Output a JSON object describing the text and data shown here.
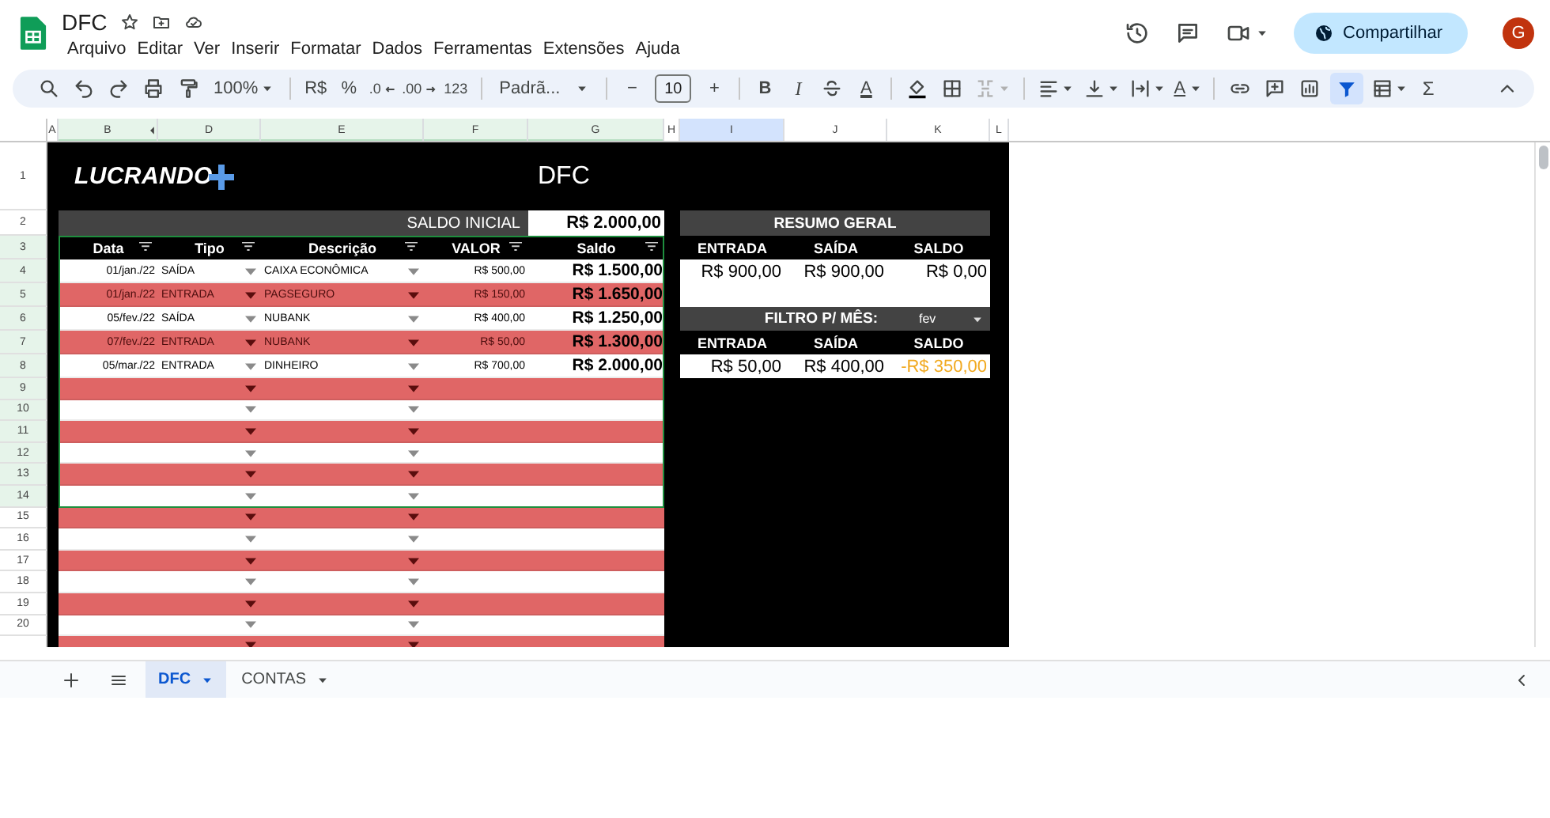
{
  "document": {
    "title": "DFC"
  },
  "menus": [
    "Arquivo",
    "Editar",
    "Ver",
    "Inserir",
    "Formatar",
    "Dados",
    "Ferramentas",
    "Extensões",
    "Ajuda"
  ],
  "share_button": "Compartilhar",
  "avatar": "G",
  "toolbar": {
    "zoom": "100%",
    "currency": "R$",
    "percent": "%",
    "decrease_decimals": ".0",
    "increase_decimals": ".00",
    "number_format": "123",
    "font": "Padrã...",
    "decrease_size": "−",
    "font_size": "10",
    "increase_size": "+",
    "bold": "B",
    "italic": "I",
    "text_color": "A",
    "text_rotation": "A",
    "functions": "Σ",
    "filter_on": true
  },
  "column_headers": [
    {
      "label": "A",
      "in_range": false,
      "selected": false
    },
    {
      "label": "B",
      "in_range": true,
      "selected": false
    },
    {
      "label": "D",
      "in_range": true,
      "selected": false
    },
    {
      "label": "E",
      "in_range": true,
      "selected": false
    },
    {
      "label": "F",
      "in_range": true,
      "selected": false
    },
    {
      "label": "G",
      "in_range": true,
      "selected": false
    },
    {
      "label": "H",
      "in_range": false,
      "selected": false
    },
    {
      "label": "I",
      "in_range": false,
      "selected": true
    },
    {
      "label": "J",
      "in_range": false,
      "selected": false
    },
    {
      "label": "K",
      "in_range": false,
      "selected": false
    },
    {
      "label": "L",
      "in_range": false,
      "selected": false
    }
  ],
  "row_headers": [
    {
      "label": "1",
      "in_range": false
    },
    {
      "label": "2",
      "in_range": false
    },
    {
      "label": "3",
      "in_range": true
    },
    {
      "label": "4",
      "in_range": true
    },
    {
      "label": "5",
      "in_range": true
    },
    {
      "label": "6",
      "in_range": true
    },
    {
      "label": "7",
      "in_range": true
    },
    {
      "label": "8",
      "in_range": true
    },
    {
      "label": "9",
      "in_range": true
    },
    {
      "label": "10",
      "in_range": true
    },
    {
      "label": "11",
      "in_range": true
    },
    {
      "label": "12",
      "in_range": true
    },
    {
      "label": "13",
      "in_range": true
    },
    {
      "label": "14",
      "in_range": true
    },
    {
      "label": "15",
      "in_range": false
    },
    {
      "label": "16",
      "in_range": false
    },
    {
      "label": "17",
      "in_range": false
    },
    {
      "label": "18",
      "in_range": false
    },
    {
      "label": "19",
      "in_range": false
    },
    {
      "label": "20",
      "in_range": false
    }
  ],
  "dfc": {
    "logo": "LUCRANDO",
    "title": "DFC",
    "opening_balance_label": "SALDO INICIAL",
    "opening_balance": "R$ 2.000,00",
    "columns": [
      "Data",
      "Tipo",
      "Descrição",
      "VALOR",
      "Saldo"
    ],
    "rows": [
      {
        "kind": "entry",
        "date": "01/jan./22",
        "type": "SAÍDA",
        "description": "CAIXA ECONÔMICA",
        "value": "R$ 500,00",
        "balance": "R$ 1.500,00"
      },
      {
        "kind": "entry",
        "date": "01/jan./22",
        "type": "ENTRADA",
        "description": "PAGSEGURO",
        "value": "R$ 150,00",
        "balance": "R$ 1.650,00"
      },
      {
        "kind": "entry",
        "date": "05/fev./22",
        "type": "SAÍDA",
        "description": "NUBANK",
        "value": "R$ 400,00",
        "balance": "R$ 1.250,00"
      },
      {
        "kind": "entry",
        "date": "07/fev./22",
        "type": "ENTRADA",
        "description": "NUBANK",
        "value": "R$ 50,00",
        "balance": "R$ 1.300,00"
      },
      {
        "kind": "entry",
        "date": "05/mar./22",
        "type": "ENTRADA",
        "description": "DINHEIRO",
        "value": "R$ 700,00",
        "balance": "R$ 2.000,00"
      },
      {
        "kind": "blank"
      },
      {
        "kind": "blank"
      },
      {
        "kind": "blank"
      },
      {
        "kind": "blank"
      },
      {
        "kind": "blank"
      },
      {
        "kind": "blank"
      },
      {
        "kind": "blank"
      },
      {
        "kind": "blank"
      },
      {
        "kind": "blank"
      },
      {
        "kind": "blank"
      },
      {
        "kind": "blank"
      },
      {
        "kind": "blank"
      },
      {
        "kind": "blank"
      }
    ]
  },
  "summary": {
    "title": "RESUMO GERAL",
    "columns": [
      "ENTRADA",
      "SAÍDA",
      "SALDO"
    ],
    "values": [
      {
        "text": "R$ 900,00",
        "negative": false
      },
      {
        "text": "R$ 900,00",
        "negative": false
      },
      {
        "text": "R$ 0,00",
        "negative": false
      }
    ]
  },
  "month_filter": {
    "label": "FILTRO P/ MÊS:",
    "month": "fev",
    "columns": [
      "ENTRADA",
      "SAÍDA",
      "SALDO"
    ],
    "values": [
      {
        "text": "R$ 50,00",
        "negative": false
      },
      {
        "text": "R$ 400,00",
        "negative": false
      },
      {
        "text": "-R$ 350,00",
        "negative": true
      }
    ]
  },
  "sheet_tabs": [
    {
      "label": "DFC",
      "selected": true
    },
    {
      "label": "CONTAS",
      "selected": false
    }
  ]
}
